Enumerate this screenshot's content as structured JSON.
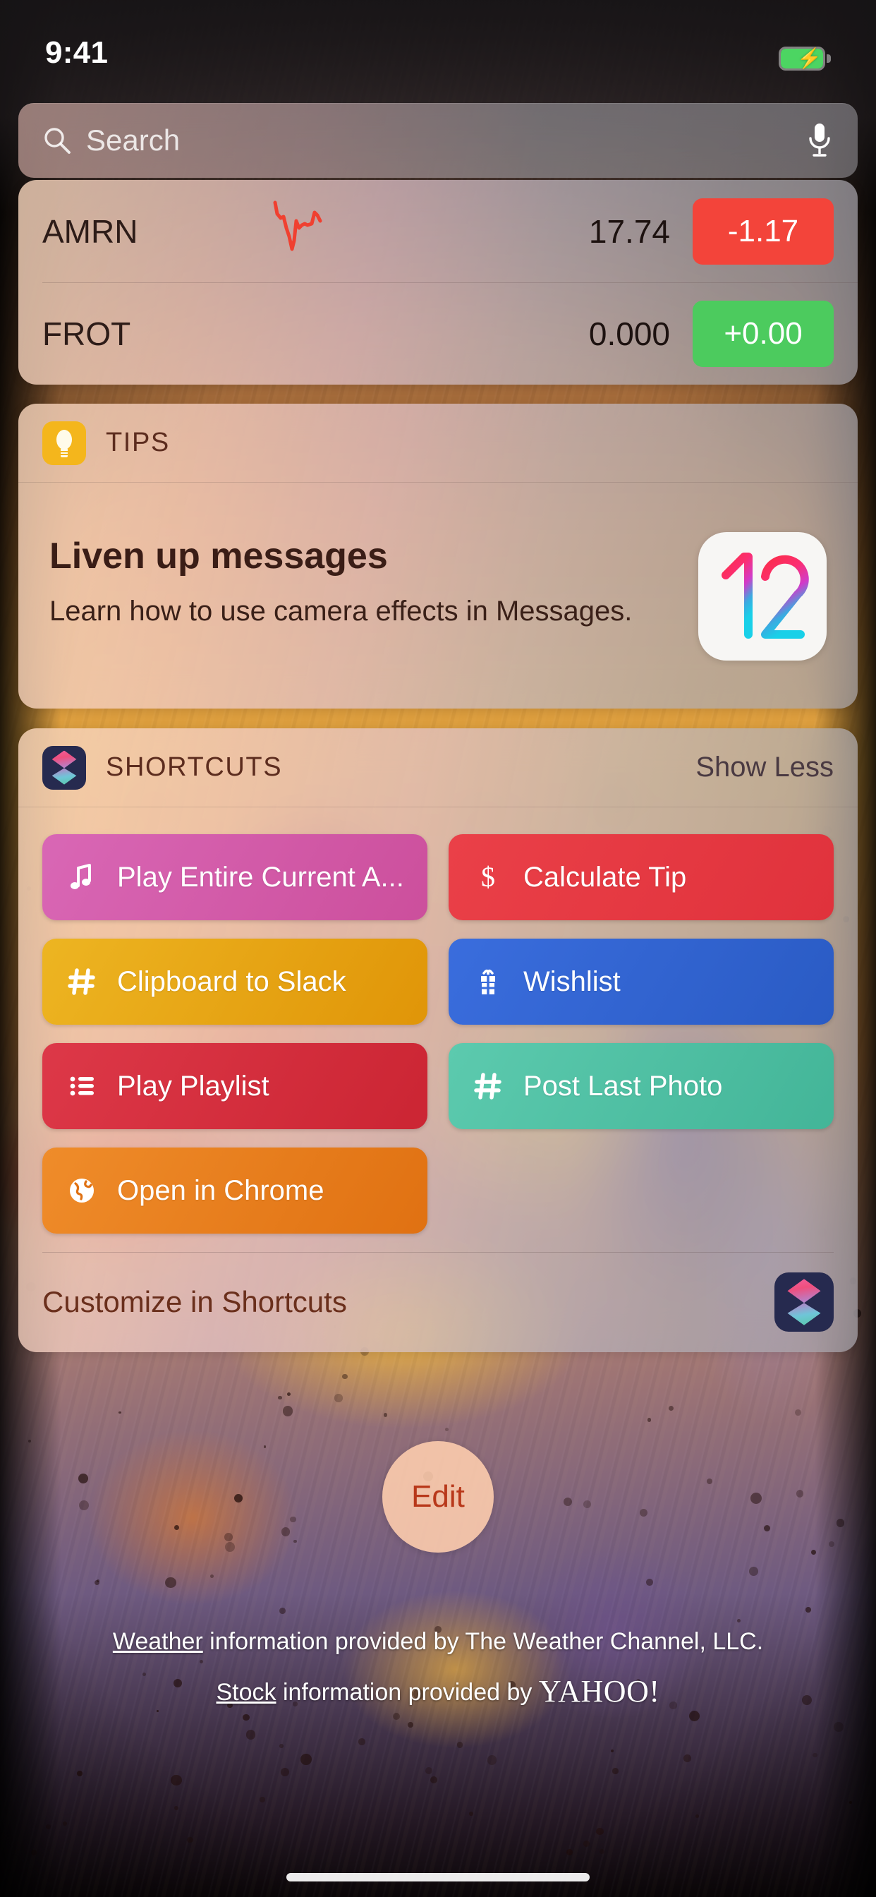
{
  "status_bar": {
    "time": "9:41",
    "battery_icon": "battery-charging-icon",
    "battery_color": "#4cd562"
  },
  "search": {
    "placeholder": "Search",
    "search_icon": "search-icon",
    "mic_icon": "microphone-icon"
  },
  "widgets": {
    "stocks": {
      "rows": [
        {
          "symbol": "AMRN",
          "price": "17.74",
          "change": "-1.17",
          "direction": "down",
          "change_color": "#f3443a",
          "sparkline": "declining"
        },
        {
          "symbol": "FROT",
          "price": "0.000",
          "change": "+0.00",
          "direction": "up",
          "change_color": "#4ccb5e",
          "sparkline": "none"
        }
      ]
    },
    "tips": {
      "header_title": "TIPS",
      "header_icon": "lightbulb-icon",
      "title": "Liven up messages",
      "subtitle": "Learn how to use camera effects in Messages.",
      "badge_icon": "ios-12-icon",
      "badge_text": "12"
    },
    "shortcuts": {
      "header_title": "SHORTCUTS",
      "header_icon": "shortcuts-app-icon",
      "show_less_label": "Show Less",
      "items": [
        {
          "label": "Play Entire Current A...",
          "icon": "music-note-icon",
          "color": "#d459a6"
        },
        {
          "label": "Calculate Tip",
          "icon": "dollar-sign-icon",
          "color": "#e53b43"
        },
        {
          "label": "Clipboard to Slack",
          "icon": "hashtag-icon",
          "color": "#e8a317"
        },
        {
          "label": "Wishlist",
          "icon": "gift-icon",
          "color": "#2f62cf"
        },
        {
          "label": "Play Playlist",
          "icon": "list-icon",
          "color": "#d6313e"
        },
        {
          "label": "Post Last Photo",
          "icon": "hashtag-icon",
          "color": "#4cbfa4"
        },
        {
          "label": "Open in Chrome",
          "icon": "globe-icon",
          "color": "#e8801e"
        }
      ],
      "footer_label": "Customize in Shortcuts",
      "footer_icon": "shortcuts-app-icon"
    }
  },
  "edit_button": {
    "label": "Edit",
    "color": "#b8381a"
  },
  "attribution": {
    "weather_link": "Weather",
    "weather_rest": " information provided by The Weather Channel, LLC.",
    "stock_link": "Stock",
    "stock_rest": " information provided by ",
    "stock_brand": "YAHOO!"
  },
  "home_indicator": "home-indicator"
}
